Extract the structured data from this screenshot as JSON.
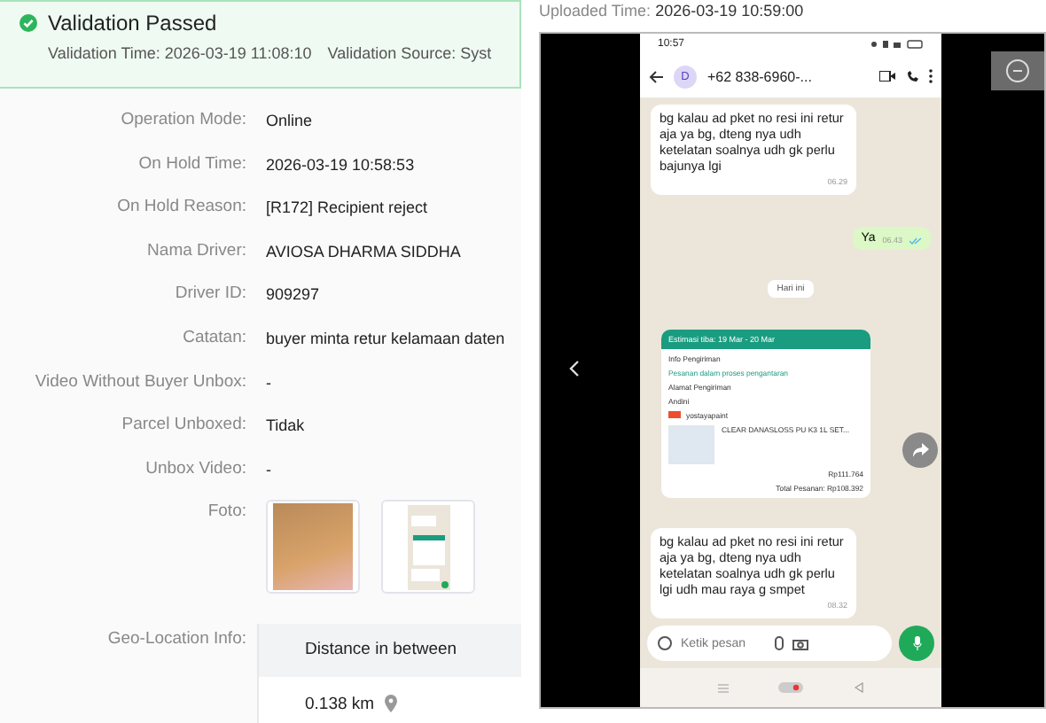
{
  "banner": {
    "title": "Validation Passed",
    "time": "Validation Time: 2026-03-19 11:08:10",
    "source": "Validation Source: Syst"
  },
  "details": [
    {
      "label": "Operation Mode:",
      "value": "Online"
    },
    {
      "label": "On Hold Time:",
      "value": "2026-03-19 10:58:53"
    },
    {
      "label": "On Hold Reason:",
      "value": "[R172] Recipient reject"
    },
    {
      "label": "Nama Driver:",
      "value": "AVIOSA DHARMA SIDDHA"
    },
    {
      "label": "Driver ID:",
      "value": "909297"
    },
    {
      "label": "Catatan:",
      "value": "buyer minta retur kelamaan daten"
    },
    {
      "label": "Video Without Buyer Unbox:",
      "value": "-"
    },
    {
      "label": "Parcel Unboxed:",
      "value": "Tidak"
    },
    {
      "label": "Unbox Video:",
      "value": "-"
    }
  ],
  "foto": {
    "label": "Foto:",
    "thumbnails": [
      {
        "kind": "photo"
      },
      {
        "kind": "screenshot"
      }
    ]
  },
  "geo": {
    "label": "Geo-Location Info:",
    "column": "Distance in between",
    "distance": "0.138 km"
  },
  "viewer": {
    "uploaded_label": "Uploaded Time:",
    "uploaded_time": "2026-03-19 10:59:00",
    "phone": {
      "status_time": "10:57",
      "avatar": "D",
      "contact": "+62 838-6960-...",
      "input_placeholder": "Ketik pesan",
      "messages": [
        {
          "kind": "in",
          "text": "bg kalau ad pket no resi ini retur aja ya bg, dteng nya udh ketelatan soalnya udh gk perlu bajunya lgi",
          "time": "06.29"
        },
        {
          "kind": "out",
          "text": "Ya",
          "time": "06.43"
        },
        {
          "kind": "date",
          "text": "Hari ini"
        },
        {
          "kind": "order",
          "header": "Estimasi tiba: 19 Mar - 20 Mar",
          "info_title": "Info Pengiriman",
          "status": "Pesanan dalam proses pengantaran",
          "address_title": "Alamat Pengiriman",
          "recipient": "Andini",
          "shop": "yostayapaint",
          "product": "CLEAR DANASLOSS PU K3 1L SET...",
          "price": "Rp111.764",
          "total": "Total Pesanan: Rp108.392"
        },
        {
          "kind": "in",
          "text": "bg kalau ad pket no resi ini retur aja ya bg, dteng nya udh ketelatan soalnya udh gk perlu  lgi udh mau raya g smpet",
          "time": "08.32"
        }
      ]
    }
  }
}
